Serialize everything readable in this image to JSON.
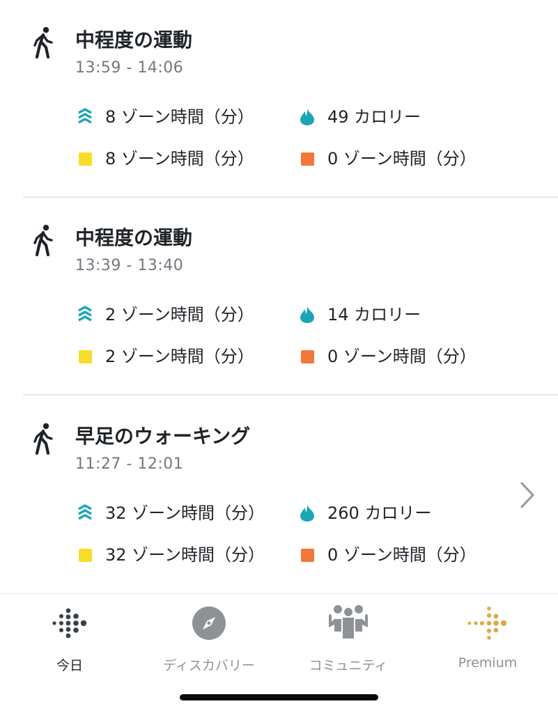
{
  "activities": [
    {
      "title": "中程度の運動",
      "time": "13:59 - 14:06",
      "zone_minutes": "8 ゾーン時間（分）",
      "calories": "49 カロリー",
      "fat_burn": "8 ゾーン時間（分）",
      "cardio": "0 ゾーン時間（分）"
    },
    {
      "title": "中程度の運動",
      "time": "13:39 - 13:40",
      "zone_minutes": "2 ゾーン時間（分）",
      "calories": "14 カロリー",
      "fat_burn": "2 ゾーン時間（分）",
      "cardio": "0 ゾーン時間（分）"
    },
    {
      "title": "早足のウォーキング",
      "time": "11:27 - 12:01",
      "zone_minutes": "32 ゾーン時間（分）",
      "calories": "260 カロリー",
      "fat_burn": "32 ゾーン時間（分）",
      "cardio": "0 ゾーン時間（分）"
    }
  ],
  "icons": {
    "activity": "walking-person-icon",
    "zone_minutes": "zone-chevrons-icon",
    "calories": "flame-icon",
    "fat_burn": "yellow-square-icon",
    "cardio": "orange-square-icon",
    "detail": "chevron-right-icon"
  },
  "tabs": [
    {
      "label": "今日",
      "icon": "fitbit-logo-icon",
      "active": true
    },
    {
      "label": "ディスカバリー",
      "icon": "compass-icon",
      "active": false
    },
    {
      "label": "コミュニティ",
      "icon": "community-people-icon",
      "active": false
    },
    {
      "label": "Premium",
      "icon": "premium-logo-icon",
      "active": false
    }
  ],
  "colors": {
    "teal": "#1aa6b7",
    "fat_burn_yellow": "#f7dd2a",
    "cardio_orange": "#f3763a",
    "premium_gold": "#e1a94b",
    "tab_active": "#1f2328",
    "tab_inactive": "#8e9296",
    "divider": "#e6e8ea"
  }
}
